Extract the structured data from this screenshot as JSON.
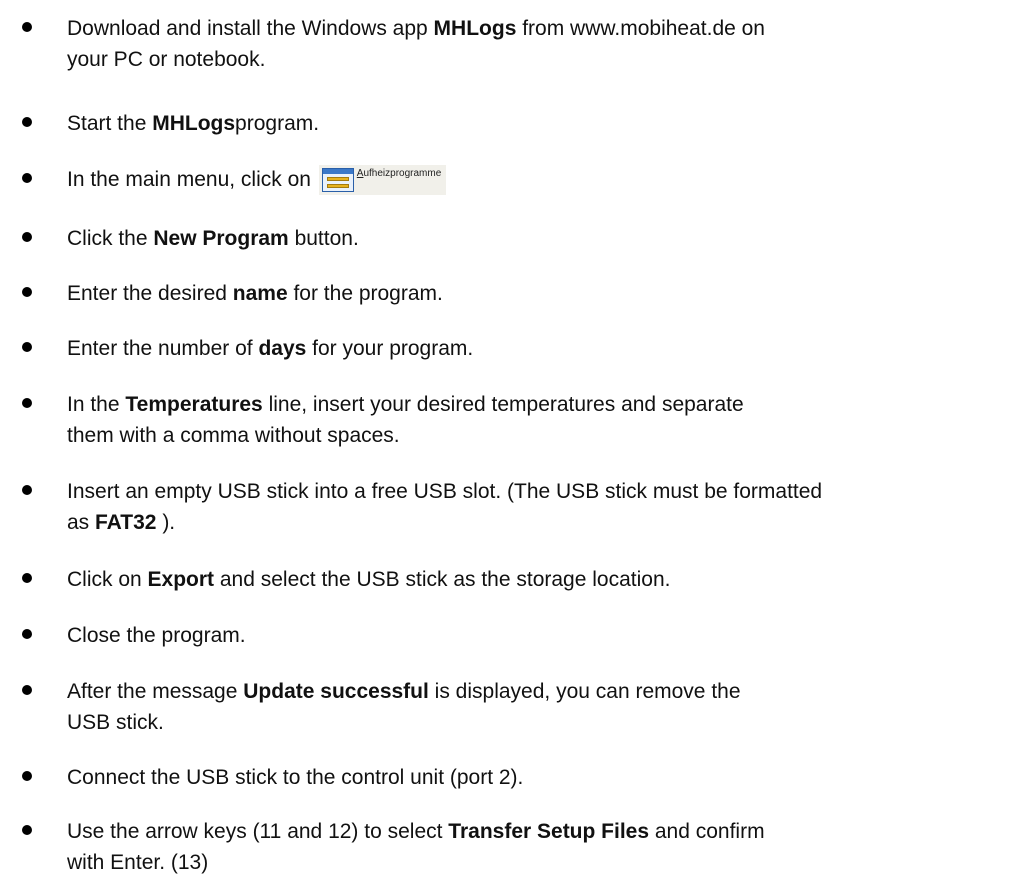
{
  "steps": [
    {
      "parts": [
        {
          "t": "Download and install the Windows app "
        },
        {
          "t": "MHLogs",
          "b": true
        },
        {
          "t": " from www.mobiheat.de on"
        },
        {
          "br": true
        },
        {
          "t": "your PC or notebook."
        }
      ]
    },
    {
      "parts": [
        {
          "t": "Start the "
        },
        {
          "t": "MHLogs",
          "b": true
        },
        {
          "t": "program."
        }
      ]
    },
    {
      "parts": [
        {
          "t": "In the main menu, click on "
        },
        {
          "button": {
            "underlined": "A",
            "rest": "ufheizprogramme",
            "icon": "program-list-icon"
          }
        }
      ]
    },
    {
      "parts": [
        {
          "t": "Click the "
        },
        {
          "t": "New Program",
          "b": true
        },
        {
          "t": " button."
        }
      ]
    },
    {
      "parts": [
        {
          "t": "Enter the desired "
        },
        {
          "t": "name",
          "b": true
        },
        {
          "t": " for the program."
        }
      ]
    },
    {
      "parts": [
        {
          "t": "Enter the number of "
        },
        {
          "t": "days",
          "b": true
        },
        {
          "t": " for your program."
        }
      ]
    },
    {
      "parts": [
        {
          "t": "In the "
        },
        {
          "t": "Temperatures",
          "b": true
        },
        {
          "t": " line, insert your desired temperatures and separate"
        },
        {
          "br": true
        },
        {
          "t": "them with a comma without spaces."
        }
      ]
    },
    {
      "parts": [
        {
          "t": "Insert an empty USB stick into a free USB slot. (The USB stick must be formatted"
        },
        {
          "br": true
        },
        {
          "t": "as "
        },
        {
          "t": "FAT32",
          "b": true
        },
        {
          "t": " )."
        }
      ]
    },
    {
      "parts": [
        {
          "t": "Click on "
        },
        {
          "t": "Export",
          "b": true
        },
        {
          "t": " and select the USB stick as the storage location."
        }
      ]
    },
    {
      "parts": [
        {
          "t": "Close the program."
        }
      ]
    },
    {
      "parts": [
        {
          "t": "After the message "
        },
        {
          "t": "Update successful",
          "b": true
        },
        {
          "t": " is displayed, you can remove the"
        },
        {
          "br": true
        },
        {
          "t": "USB stick."
        }
      ]
    },
    {
      "parts": [
        {
          "t": "Connect the USB stick to the control unit (port 2)."
        }
      ]
    },
    {
      "parts": [
        {
          "t": "Use the arrow keys (11 and 12) to select "
        },
        {
          "t": "Transfer Setup Files",
          "b": true
        },
        {
          "t": " and confirm"
        },
        {
          "br": true
        },
        {
          "t": "with Enter. (13)"
        }
      ]
    }
  ]
}
